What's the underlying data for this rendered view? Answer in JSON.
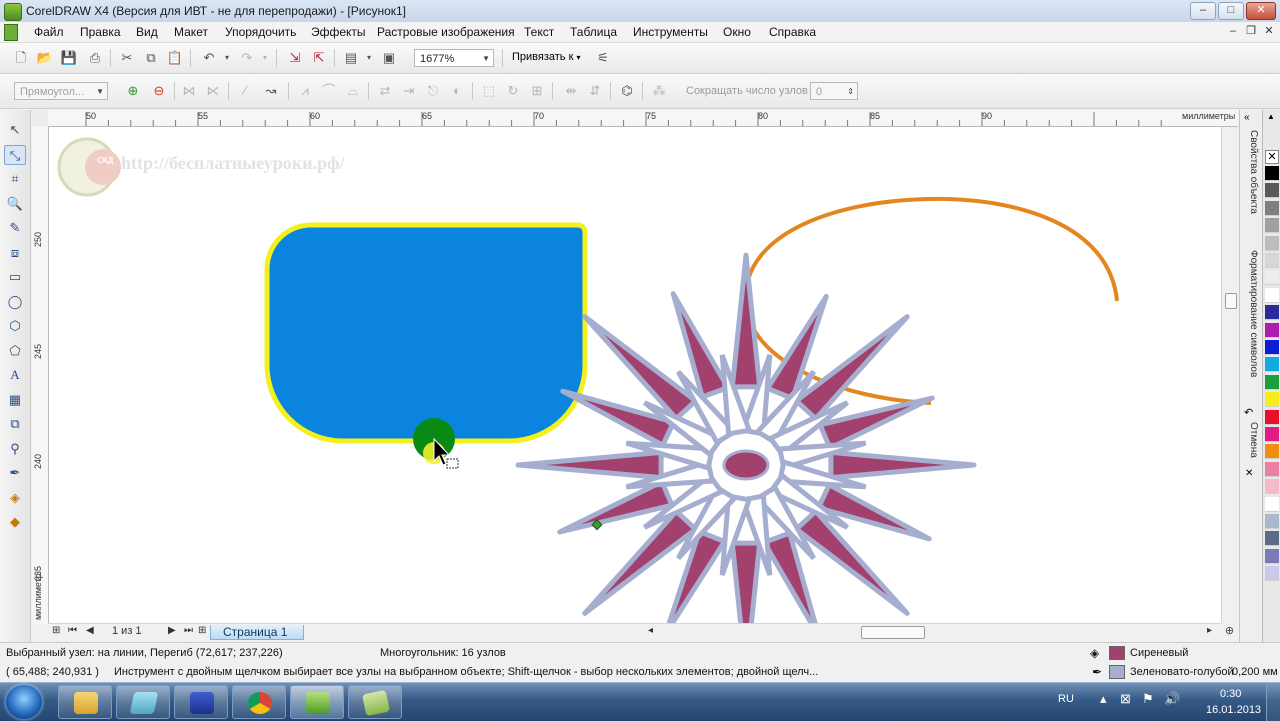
{
  "window": {
    "title": "CorelDRAW X4 (Версия для ИВТ - не для перепродажи) - [Рисунок1]"
  },
  "menu": [
    "Файл",
    "Правка",
    "Вид",
    "Макет",
    "Упорядочить",
    "Эффекты",
    "Растровые изображения",
    "Текст",
    "Таблица",
    "Инструменты",
    "Окно",
    "Справка"
  ],
  "toolbar1": {
    "zoom": "1677%",
    "snap_label": "Привязать к"
  },
  "toolbar2": {
    "shape_combo": "Прямоугол...",
    "reduce_nodes_label": "Сокращать число узлов",
    "reduce_nodes_value": "0"
  },
  "rulers": {
    "unit": "миллиметры",
    "h_ticks": [
      "50",
      "55",
      "60",
      "65",
      "70",
      "75",
      "80",
      "85",
      "90"
    ],
    "v_ticks": [
      "250",
      "245",
      "240",
      "235"
    ]
  },
  "watermark": "http://бесплатныеуроки.рф/",
  "logo_text": "СКД",
  "page_nav": {
    "count": "1 из 1",
    "tab": "Страница 1"
  },
  "dockers": [
    "Свойства объекта",
    "Форматирование символов",
    "Отмена"
  ],
  "palette": [
    "#000000",
    "#5a5a5a",
    "#808080",
    "#a0a0a0",
    "#bdbdbd",
    "#d6d6d6",
    "#ececec",
    "#ffffff",
    "#2a2a9a",
    "#b31cb1",
    "#0b1bd6",
    "#12a8e0",
    "#1a9f3a",
    "#f6ee16",
    "#e8102a",
    "#e11c84",
    "#f28c0f",
    "#ef7fa2",
    "#f7b9c7",
    "#ffffff",
    "#a9b9cc",
    "#5b6a86",
    "#7a7ab8",
    "#c9c9e8"
  ],
  "status": {
    "line1_left": "Выбранный узел: на линии, Перегиб (72,617; 237,226)",
    "line1_mid": "Многоугольник: 16 узлов",
    "line2_coords": "( 65,488; 240,931 )",
    "line2_hint": "Инструмент с двойным щелчком выбирает все узлы на выбранном объекте; Shift-щелчок - выбор нескольких элементов; двойной щелч...",
    "fill_name": "Сиреневый",
    "fill_color": "#a3416e",
    "outline_name": "Зеленовато-голубой",
    "outline_width": "0,200 мм",
    "outline_color": "#a6aed0"
  },
  "taskbar": {
    "lang": "RU",
    "time": "0:30",
    "date": "16.01.2013"
  },
  "colors": {
    "blue_shape": "#0a84df",
    "blue_outline": "#f4f01e",
    "arc": "#e3861f",
    "star_fill": "#a3416e",
    "star_outline": "#a6aed0"
  }
}
